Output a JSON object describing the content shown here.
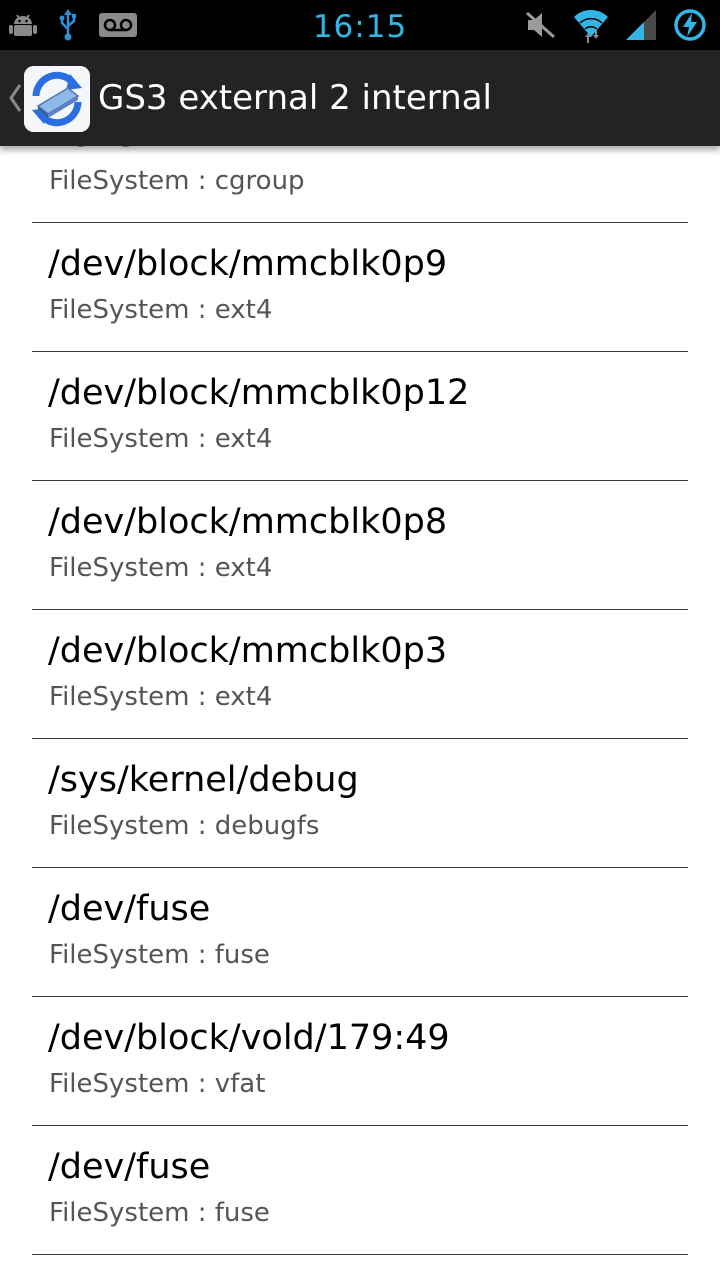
{
  "status_bar": {
    "time": "16:15",
    "left_icons": [
      "android-debug-icon",
      "usb-icon",
      "voicemail-icon"
    ],
    "right_icons": [
      "muted-icon",
      "wifi-icon",
      "signal-icon",
      "battery-charging-icon"
    ],
    "accent_color": "#33b5e5"
  },
  "action_bar": {
    "title": "GS3 external 2 internal",
    "background": "#232323"
  },
  "mounts": [
    {
      "device": "none",
      "filesystem": "FileSystem : cgroup"
    },
    {
      "device": "/dev/block/mmcblk0p9",
      "filesystem": "FileSystem : ext4"
    },
    {
      "device": "/dev/block/mmcblk0p12",
      "filesystem": "FileSystem : ext4"
    },
    {
      "device": "/dev/block/mmcblk0p8",
      "filesystem": "FileSystem : ext4"
    },
    {
      "device": "/dev/block/mmcblk0p3",
      "filesystem": "FileSystem : ext4"
    },
    {
      "device": "/sys/kernel/debug",
      "filesystem": "FileSystem : debugfs"
    },
    {
      "device": "/dev/fuse",
      "filesystem": "FileSystem : fuse"
    },
    {
      "device": "/dev/block/vold/179:49",
      "filesystem": "FileSystem : vfat"
    },
    {
      "device": "/dev/fuse",
      "filesystem": "FileSystem : fuse"
    }
  ]
}
